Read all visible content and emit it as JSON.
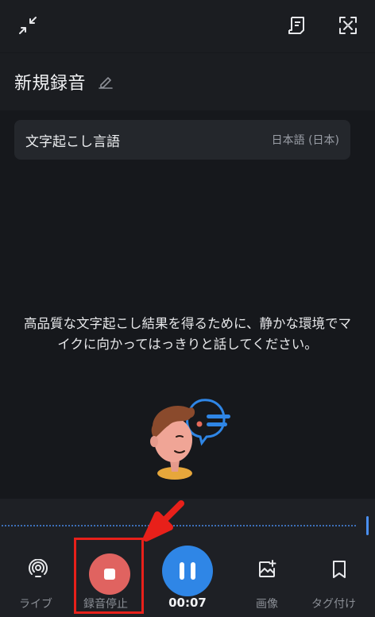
{
  "header": {
    "title": "新規録音"
  },
  "transcription": {
    "label": "文字起こし言語",
    "value": "日本語 (日本)"
  },
  "hint": "高品質な文字起こし結果を得るために、静かな環境でマイクに向かってはっきりと話してください。",
  "toolbar": {
    "live_label": "ライブ",
    "stop_label": "録音停止",
    "timer": "00:07",
    "image_label": "画像",
    "tag_label": "タグ付け"
  },
  "colors": {
    "background": "#16181c",
    "stop_red": "#e06360",
    "pause_blue": "#2f86e6",
    "annotation_red": "#e8201a"
  },
  "icons": [
    "collapse-icon",
    "note-list-icon",
    "expand-icon",
    "edit-pencil-icon",
    "live-broadcast-icon",
    "image-add-icon",
    "bookmark-icon"
  ]
}
